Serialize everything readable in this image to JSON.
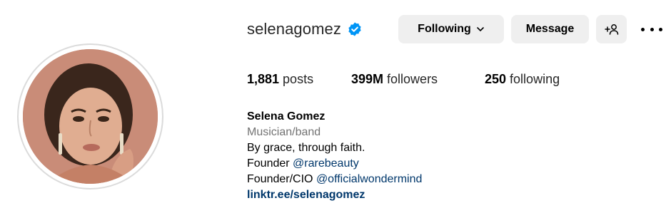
{
  "profile": {
    "username": "selenagomez",
    "verified": true,
    "display_name": "Selena Gomez",
    "category": "Musician/band",
    "bio_line_1": "By grace, through faith.",
    "bio_line_2_prefix": "Founder ",
    "bio_line_2_mention": "@rarebeauty",
    "bio_line_3_prefix": "Founder/CIO ",
    "bio_line_3_mention": "@officialwondermind",
    "link": "linktr.ee/selenagomez"
  },
  "actions": {
    "following_label": "Following",
    "message_label": "Message",
    "add_user_icon": "add-user-icon",
    "more_icon": "more-options-icon"
  },
  "stats": {
    "posts_count": "1,881",
    "posts_label": " posts",
    "followers_count": "399M",
    "followers_label": " followers",
    "following_count": "250",
    "following_label": " following"
  },
  "colors": {
    "verified_blue": "#0095f6",
    "button_bg": "#efefef",
    "link_blue": "#00376b",
    "category_gray": "#737373"
  }
}
